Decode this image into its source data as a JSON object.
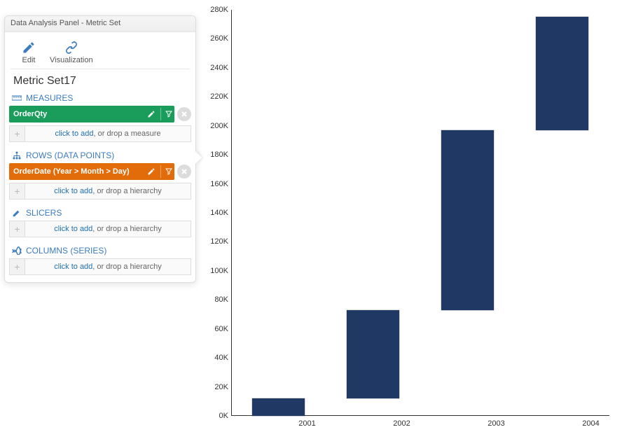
{
  "panel": {
    "title": "Data Analysis Panel - Metric Set",
    "toolbar": {
      "edit": "Edit",
      "visualization": "Visualization"
    },
    "name": "Metric Set17",
    "sections": {
      "measures": {
        "label": "MEASURES"
      },
      "rows": {
        "label": "ROWS (DATA POINTS)"
      },
      "slicers": {
        "label": "SLICERS"
      },
      "columns": {
        "label": "COLUMNS (SERIES)"
      }
    },
    "items": {
      "measure": "OrderQty",
      "row": "OrderDate (Year > Month > Day)"
    },
    "placeholders": {
      "measure_link": "click to add",
      "measure_rest": ", or drop a measure",
      "hierarchy_link": "click to add",
      "hierarchy_rest": ", or drop a hierarchy"
    }
  },
  "chart_data": {
    "type": "bar",
    "variant": "waterfall",
    "categories": [
      "2001",
      "2002",
      "2003",
      "2004"
    ],
    "values": [
      12000,
      61000,
      124000,
      78000
    ],
    "cumulative": [
      12000,
      73000,
      197000,
      275000
    ],
    "xlabel": "",
    "ylabel": "",
    "ylim": [
      0,
      280000
    ],
    "ytick_step": 20000,
    "bar_color": "#203864"
  }
}
